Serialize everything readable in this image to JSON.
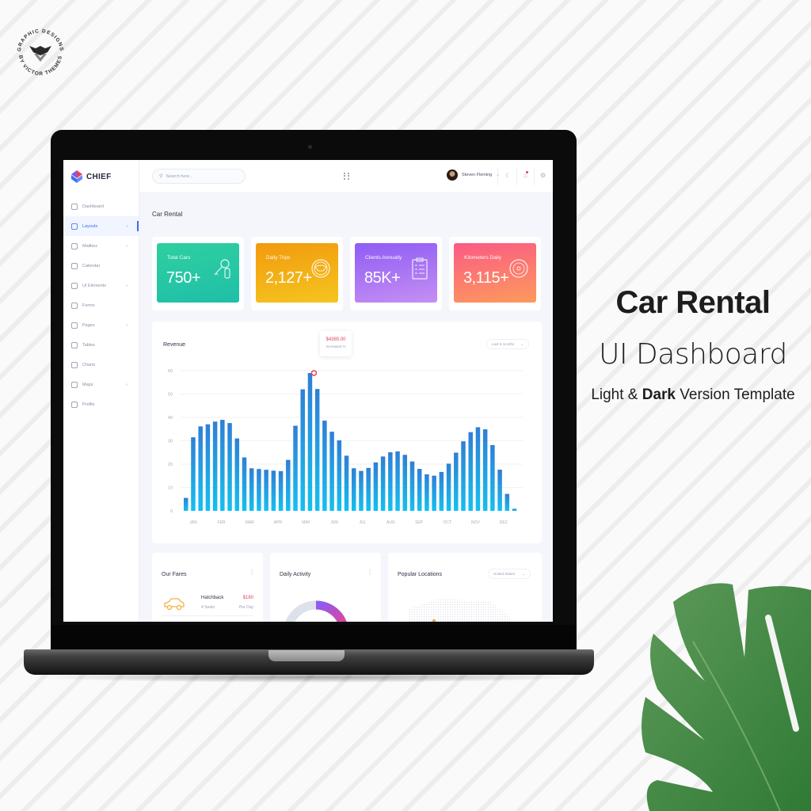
{
  "badge": {
    "top_text": "GRAPHIC DESIGNS",
    "bottom_text": "BY VICTOR THEMES",
    "icon": "victor-themes-logo-icon"
  },
  "promo": {
    "title": "Car Rental",
    "subtitle": "UI Dashboard",
    "line_part1": "Light & ",
    "line_bold": "Dark",
    "line_part2": " Version Template"
  },
  "app": {
    "brand": "CHIEF",
    "search": {
      "placeholder": "Search here..",
      "value": ""
    },
    "user": {
      "name": "Steven Fleming",
      "caret": "⌄"
    },
    "top_icons": [
      "grid-icon",
      "moon-icon",
      "bell-icon",
      "gear-icon"
    ],
    "sidebar": {
      "items": [
        {
          "label": "Dashboard",
          "icon": "dashboard-icon",
          "has_caret": false,
          "active": false
        },
        {
          "label": "Layouts",
          "icon": "layout-icon",
          "has_caret": true,
          "active": true
        },
        {
          "label": "Mailbox",
          "icon": "mailbox-icon",
          "has_caret": true,
          "active": false
        },
        {
          "label": "Calendar",
          "icon": "calendar-icon",
          "has_caret": false,
          "active": false
        },
        {
          "label": "UI Elements",
          "icon": "ui-elements-icon",
          "has_caret": true,
          "active": false
        },
        {
          "label": "Forms",
          "icon": "forms-icon",
          "has_caret": false,
          "active": false
        },
        {
          "label": "Pages",
          "icon": "pages-icon",
          "has_caret": true,
          "active": false
        },
        {
          "label": "Tables",
          "icon": "tables-icon",
          "has_caret": false,
          "active": false
        },
        {
          "label": "Charts",
          "icon": "charts-icon",
          "has_caret": false,
          "active": false
        },
        {
          "label": "Maps",
          "icon": "maps-icon",
          "has_caret": true,
          "active": false
        },
        {
          "label": "Profile",
          "icon": "profile-icon",
          "has_caret": false,
          "active": false
        }
      ],
      "caret_glyph": "‹"
    },
    "page_title": "Car Rental",
    "stats": [
      {
        "label": "Total Cars",
        "value": "750+",
        "icon": "car-key-icon",
        "color_from": "#2fcfa0",
        "color_to": "#1fbfa8"
      },
      {
        "label": "Daily Trips",
        "value": "2,127+",
        "icon": "steering-wheel-icon",
        "color_from": "#f29a0e",
        "color_to": "#f4c51f"
      },
      {
        "label": "Clients Annually",
        "value": "85K+",
        "icon": "clipboard-icon",
        "color_from": "#8f5cf5",
        "color_to": "#c48ff3"
      },
      {
        "label": "Kilometers Daily",
        "value": "3,115+",
        "icon": "speedometer-icon",
        "color_from": "#fb5b84",
        "color_to": "#fc9a5c"
      }
    ],
    "revenue": {
      "title": "Revenue",
      "period": "Last 6 months",
      "tooltip_value": "$4385.00",
      "tooltip_label": "Increased %"
    },
    "fares": {
      "title": "Our Fares",
      "rows": [
        {
          "name": "Hatchback",
          "seats": "4 Seats",
          "price": "$180",
          "unit": "Per Day",
          "icon": "car-icon"
        }
      ]
    },
    "activity": {
      "title": "Daily Activity"
    },
    "locations": {
      "title": "Popular Locations",
      "region": "United States"
    }
  },
  "chart_data": {
    "type": "area",
    "title": "Revenue",
    "style": "striped-area",
    "xlabel": "",
    "ylabel": "",
    "categories": [
      "JAN",
      "FEB",
      "MAR",
      "APR",
      "MAY",
      "JUN",
      "JUL",
      "AUG",
      "SEP",
      "OCT",
      "NOV",
      "DEC"
    ],
    "yticks": [
      0,
      10,
      20,
      30,
      40,
      50,
      60
    ],
    "ylim": [
      0,
      60
    ],
    "grid": true,
    "curve_x": [
      0,
      0.5,
      1.5,
      2.5,
      3.5,
      4.5,
      5.2,
      6.2,
      7.5,
      8.8,
      10.5,
      11.8
    ],
    "curve_y": [
      0,
      36,
      39,
      18,
      17,
      59,
      34,
      17,
      25.5,
      15,
      36,
      0
    ],
    "highlight": {
      "x": 4.5,
      "y": 59,
      "label": "$4385.00"
    },
    "series_color_top": "#2f7fd6",
    "series_color_bottom": "#14c0f0"
  }
}
